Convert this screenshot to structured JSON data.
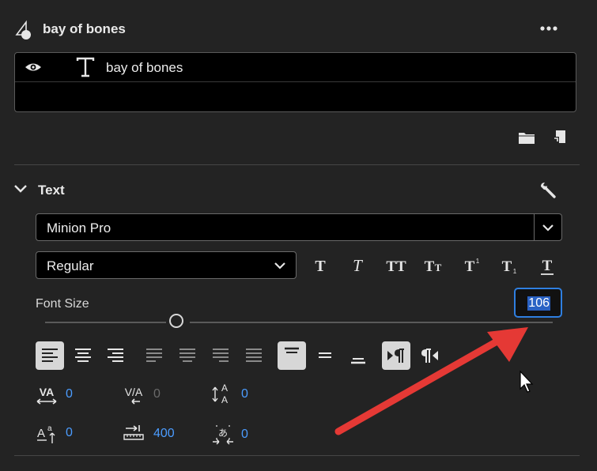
{
  "clip": {
    "title": "bay of bones",
    "more_icon": "more-horizontal-icon",
    "shape_icon": "graphic-shape-icon"
  },
  "layers": [
    {
      "name": "bay of bones",
      "visible": true,
      "type_icon": "text-layer-icon"
    }
  ],
  "section": {
    "title": "Text",
    "icon": "wrench-icon"
  },
  "font": {
    "family": "Minion Pro",
    "style": "Regular"
  },
  "font_size": {
    "label": "Font Size",
    "value": "106"
  },
  "metrics": {
    "kerning": "0",
    "tracking": "0",
    "leading": "0",
    "baseline_shift": "0",
    "tab_width": "400",
    "tsume": "0"
  },
  "colors": {
    "accent": "#4b9cff",
    "focus": "#2f7fe0",
    "annotation": "#e53935",
    "panel": "#232323"
  }
}
